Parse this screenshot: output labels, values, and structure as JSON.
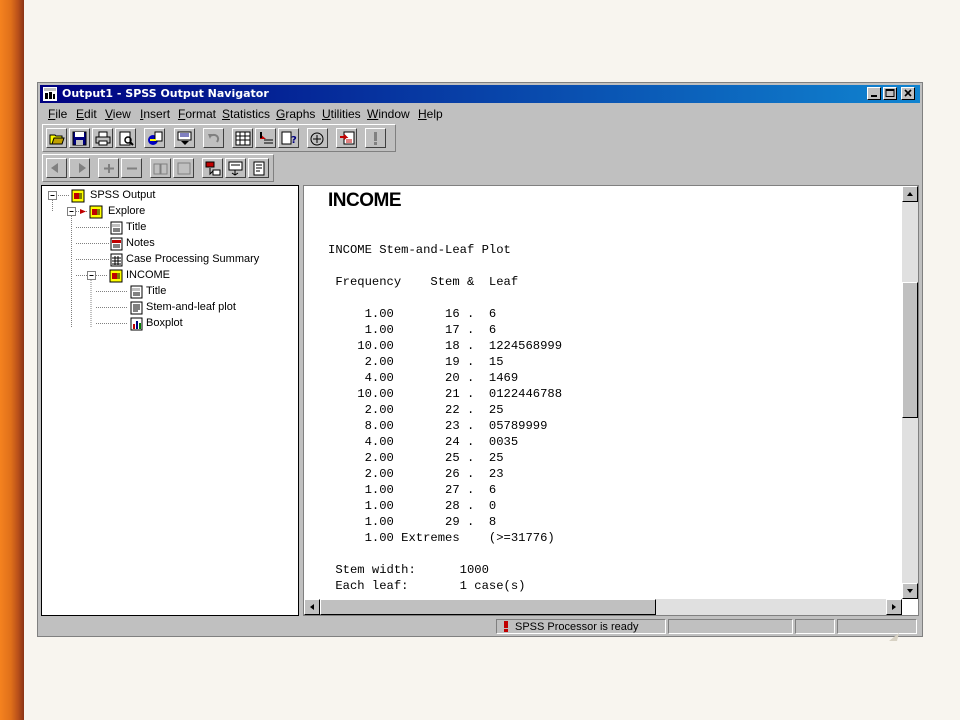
{
  "window": {
    "title": "Output1 - SPSS Output Navigator"
  },
  "menu": {
    "items": [
      "File",
      "Edit",
      "View",
      "Insert",
      "Format",
      "Statistics",
      "Graphs",
      "Utilities",
      "Window",
      "Help"
    ]
  },
  "toolbar": {
    "row1_icons": [
      "open-icon",
      "save-icon",
      "print-icon",
      "print-preview-icon",
      "export-icon",
      "goto-data-icon",
      "undo-icon",
      "variables-icon",
      "insert-case-icon",
      "help-topics-icon",
      "designate-window-icon",
      "select-last-output-icon",
      "run-icon"
    ],
    "row2_icons": [
      "promote-icon",
      "demote-icon",
      "expand-icon",
      "collapse-icon",
      "show-icon",
      "hide-icon",
      "insert-heading-icon",
      "insert-title-icon",
      "insert-text-icon"
    ]
  },
  "outline": {
    "nodes": [
      {
        "label": "SPSS Output",
        "icon": "folder-book-icon"
      },
      {
        "label": "Explore",
        "icon": "folder-book-icon"
      },
      {
        "label": "Title",
        "icon": "title-page-icon"
      },
      {
        "label": "Notes",
        "icon": "notes-page-icon"
      },
      {
        "label": "Case Processing Summary",
        "icon": "table-page-icon"
      },
      {
        "label": "INCOME",
        "icon": "folder-book-icon"
      },
      {
        "label": "Title",
        "icon": "title-page-icon"
      },
      {
        "label": "Stem-and-leaf plot",
        "icon": "text-page-icon"
      },
      {
        "label": "Boxplot",
        "icon": "chart-page-icon"
      }
    ]
  },
  "output": {
    "heading": "INCOME",
    "plot_title": "INCOME Stem-and-Leaf Plot",
    "header": " Frequency    Stem &  Leaf",
    "rows": [
      "     1.00       16 .  6",
      "     1.00       17 .  6",
      "    10.00       18 .  1224568999",
      "     2.00       19 .  15",
      "     4.00       20 .  1469",
      "    10.00       21 .  0122446788",
      "     2.00       22 .  25",
      "     8.00       23 .  05789999",
      "     4.00       24 .  0035",
      "     2.00       25 .  25",
      "     2.00       26 .  23",
      "     1.00       27 .  6",
      "     1.00       28 .  0",
      "     1.00       29 .  8",
      "     1.00 Extremes    (>=31776)"
    ],
    "stem_width": " Stem width:      1000",
    "each_leaf": " Each leaf:       1 case(s)"
  },
  "status": {
    "message": "SPSS Processor is ready"
  },
  "colors": {
    "title_bar": "#000080",
    "window_face": "#c0c0c0",
    "accent_left": "#f5821f"
  }
}
